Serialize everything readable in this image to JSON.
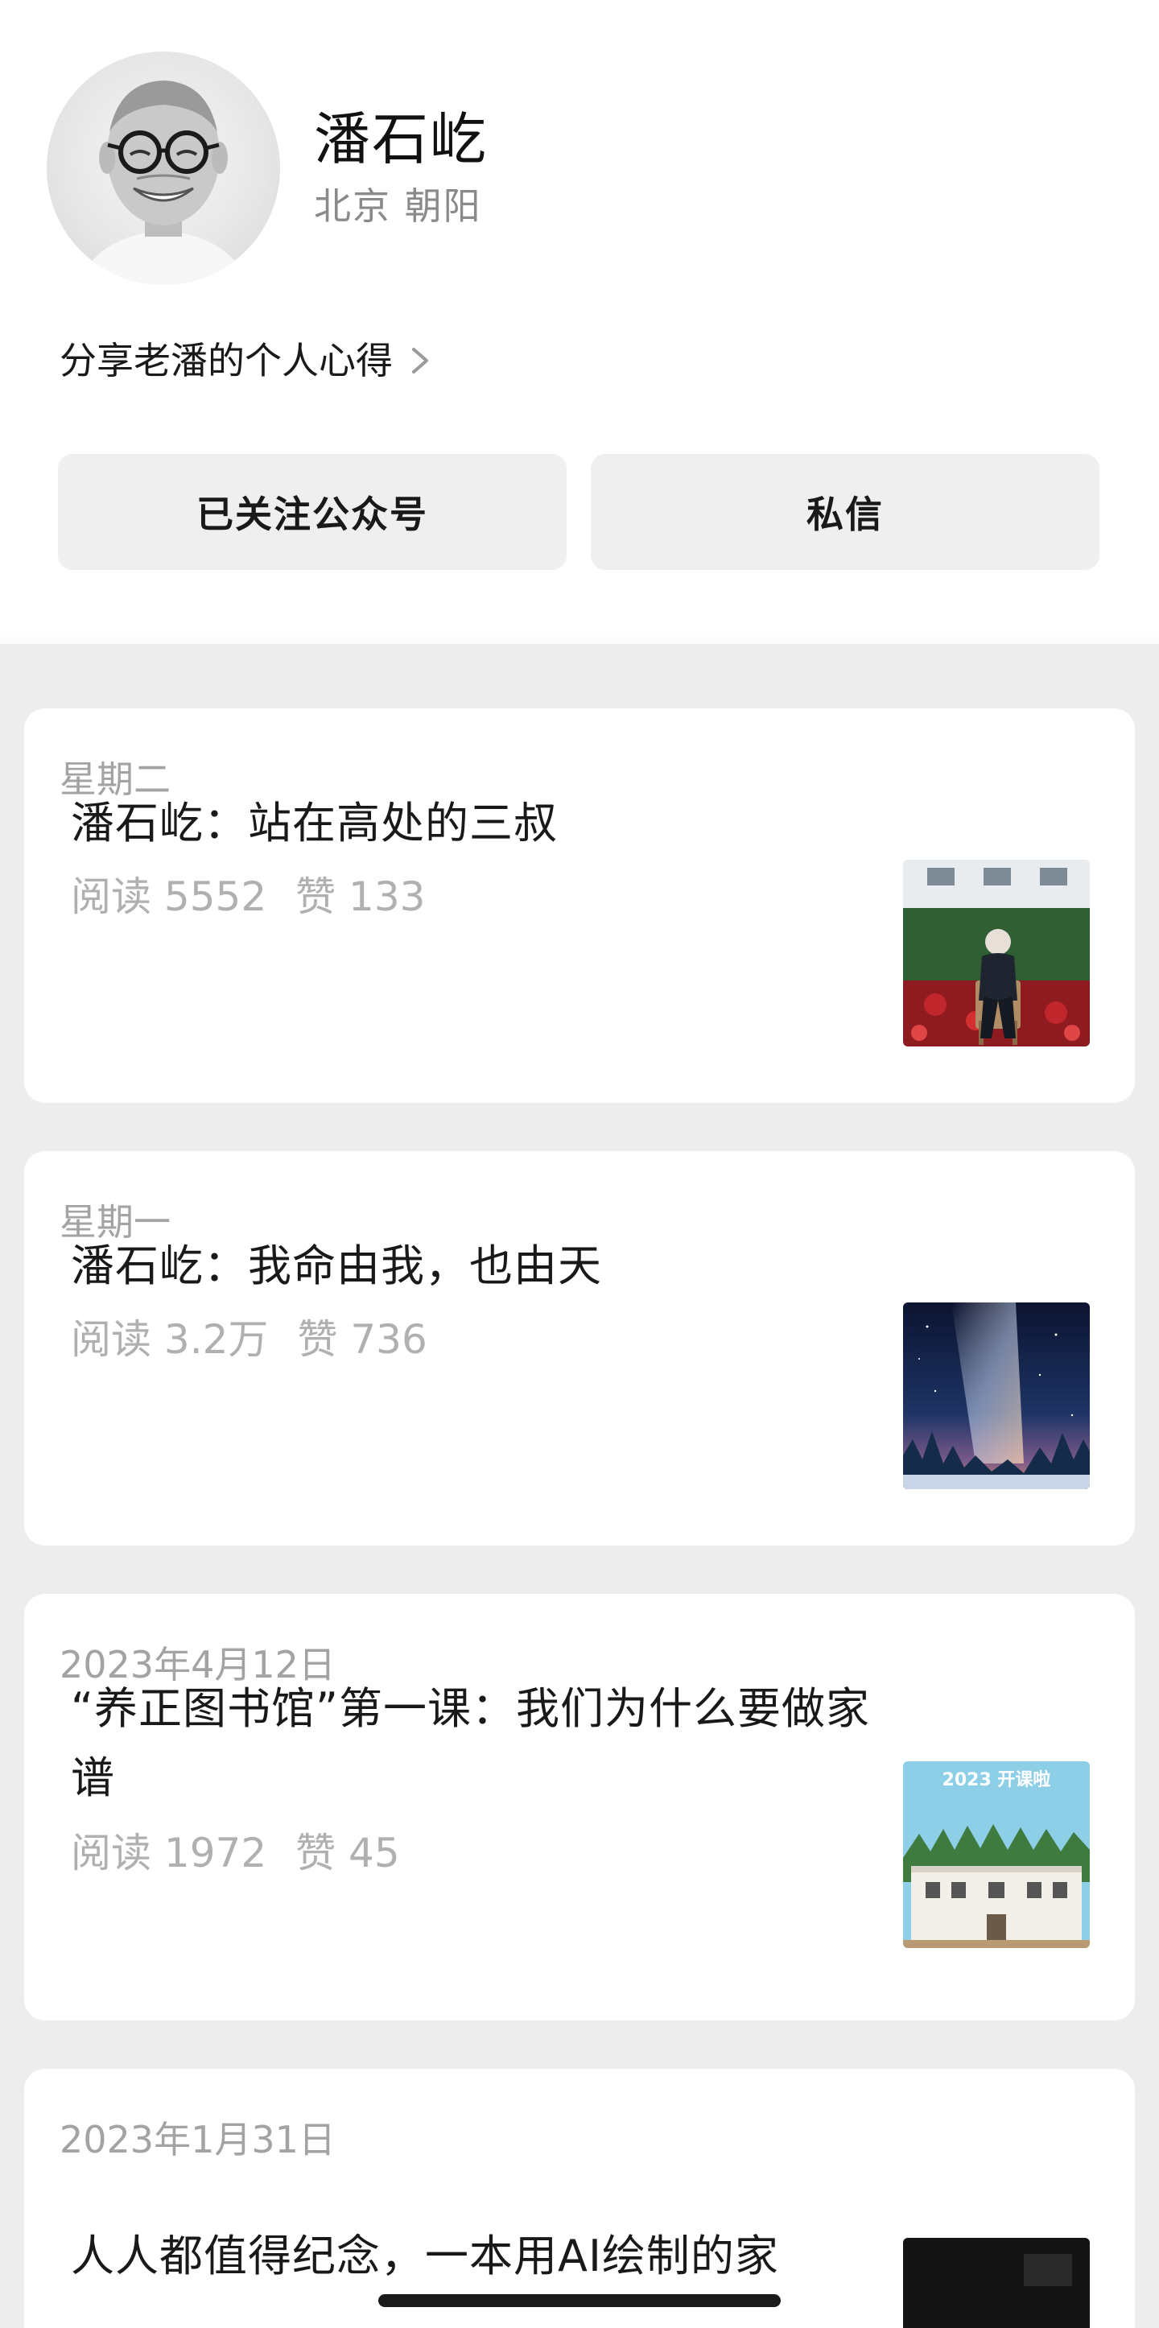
{
  "profile": {
    "name": "潘石屹",
    "location": "北京 朝阳",
    "bio": "分享老潘的个人心得",
    "avatar_icon": "person-portrait",
    "follow_button": "已关注公众号",
    "message_button": "私信"
  },
  "articles": [
    {
      "date": "星期二",
      "title": "潘石屹：站在高处的三叔",
      "reads": "阅读 5552",
      "likes": "赞 133",
      "thumbnail": "man-seated-in-garden"
    },
    {
      "date": "星期一",
      "title": "潘石屹：我命由我，也由天",
      "reads": "阅读 3.2万",
      "likes": "赞 736",
      "thumbnail": "milky-way-night-sky"
    },
    {
      "date": "2023年4月12日",
      "title": "“养正图书馆”第一课：我们为什么要做家谱",
      "reads": "阅读 1972",
      "likes": "赞 45",
      "thumbnail": "library-building-poster",
      "thumbnail_text": "2023 开课啦"
    },
    {
      "date": "2023年1月31日",
      "title": "人人都值得纪念，一本用AI绘制的家",
      "thumbnail": "dark-photo"
    }
  ]
}
